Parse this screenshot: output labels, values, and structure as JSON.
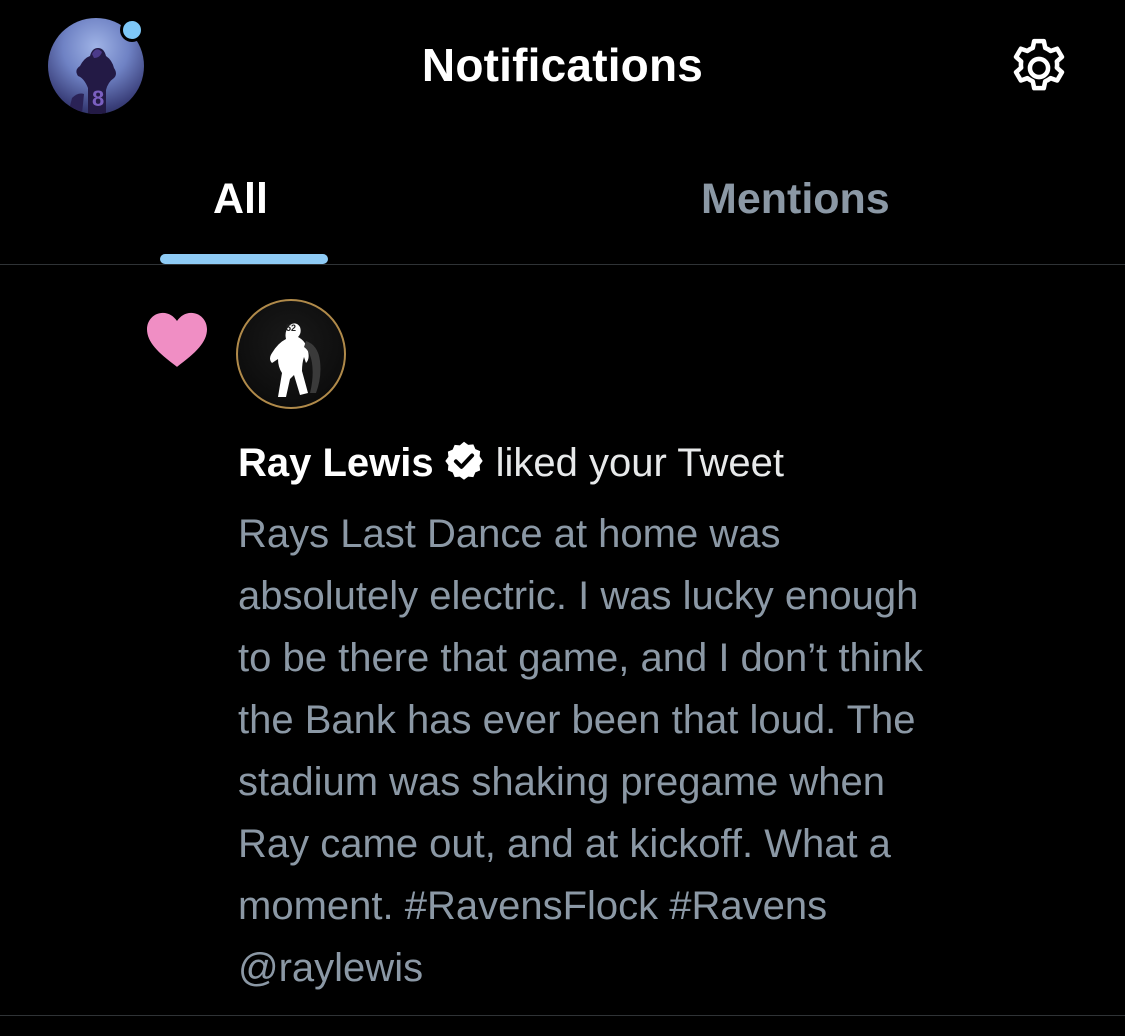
{
  "header": {
    "title": "Notifications",
    "avatar_icon": "profile-avatar",
    "settings_icon": "gear-icon"
  },
  "tabs": [
    {
      "label": "All",
      "active": true
    },
    {
      "label": "Mentions",
      "active": false
    }
  ],
  "colors": {
    "background": "#000000",
    "accent": "#8ecbf5",
    "heart": "#f08ec4",
    "primary_text": "#ffffff",
    "secondary_text": "#8b98a5"
  },
  "notification": {
    "type_icon": "heart-icon",
    "avatar_icon": "ray-lewis-avatar",
    "user_name": "Ray Lewis",
    "verified": true,
    "action": "liked your Tweet",
    "tweet_lines": [
      "Rays Last Dance at home was",
      "absolutely electric. I was lucky enough",
      "to be there that game, and I don’t think",
      "the Bank has ever been that loud. The",
      "stadium was shaking pregame when",
      "Ray came out, and at kickoff. What a",
      "moment. #RavensFlock #Ravens",
      "@raylewis"
    ]
  }
}
